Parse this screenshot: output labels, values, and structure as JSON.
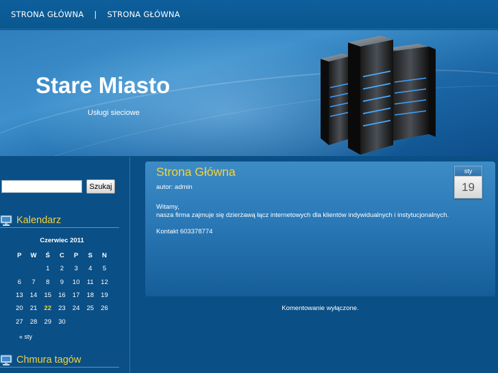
{
  "nav": {
    "items": [
      "STRONA GŁÓWNA",
      "STRONA GŁÓWNA"
    ],
    "separator": "|"
  },
  "header": {
    "title": "Stare Miasto",
    "description": "Usługi sieciowe",
    "image_icon": "server-rack-illustration"
  },
  "sidebar": {
    "search": {
      "value": "",
      "button_label": "Szukaj"
    },
    "calendar_widget": {
      "title": "Kalendarz",
      "icon": "monitor-icon",
      "caption": "Czerwiec 2011",
      "weekdays": [
        "P",
        "W",
        "Ś",
        "C",
        "P",
        "S",
        "N"
      ],
      "weeks": [
        [
          "",
          "",
          "1",
          "2",
          "3",
          "4",
          "5"
        ],
        [
          "6",
          "7",
          "8",
          "9",
          "10",
          "11",
          "12"
        ],
        [
          "13",
          "14",
          "15",
          "16",
          "17",
          "18",
          "19"
        ],
        [
          "20",
          "21",
          "22",
          "23",
          "24",
          "25",
          "26"
        ],
        [
          "27",
          "28",
          "29",
          "30",
          "",
          "",
          ""
        ]
      ],
      "highlighted_day": "22",
      "prev_link": "« sty"
    },
    "tags_widget": {
      "title": "Chmura tagów",
      "icon": "monitor-icon"
    }
  },
  "post": {
    "title": "Strona Główna",
    "meta": "autor: admin",
    "date": {
      "month": "sty",
      "day": "19"
    },
    "paragraphs": [
      "Witamy,\nnasza firma zajmuje się dzierżawą łącz internetowych dla klientów indywidualnych i instytucjonalnych.",
      "Kontakt 603378774"
    ],
    "comments_status": "Komentowanie wyłączone."
  },
  "colors": {
    "background": "#0a4f86",
    "accent_yellow": "#f2d33c",
    "header_light": "#3e90cc"
  }
}
